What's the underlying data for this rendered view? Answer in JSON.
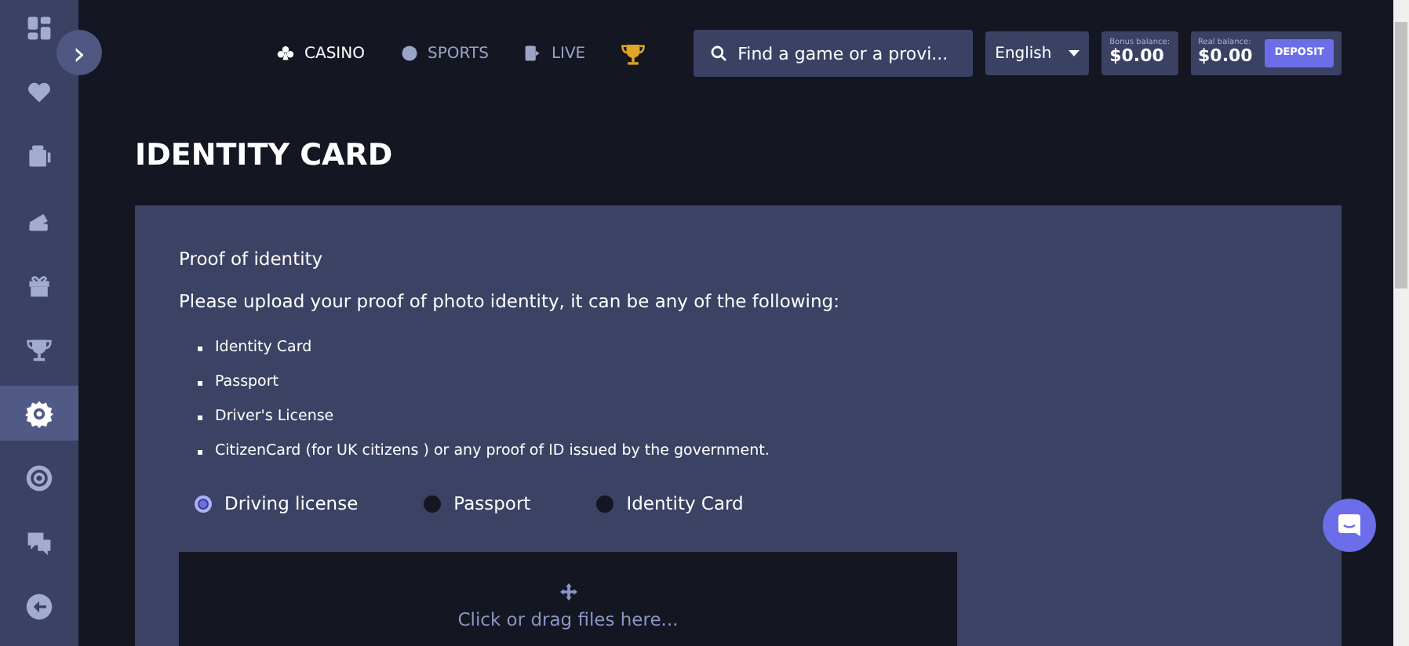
{
  "sidebar": {
    "items": [
      {
        "selected": false
      },
      {
        "selected": false
      },
      {
        "selected": false
      },
      {
        "selected": false
      },
      {
        "selected": false
      },
      {
        "selected": false
      },
      {
        "selected": true
      },
      {
        "selected": false
      },
      {
        "selected": false
      },
      {
        "selected": false
      }
    ]
  },
  "expand_button": {
    "label": "›"
  },
  "nav": [
    {
      "label": "CASINO",
      "selected": true
    },
    {
      "label": "SPORTS",
      "selected": false
    },
    {
      "label": "LIVE",
      "selected": false
    }
  ],
  "search": {
    "placeholder": "Find a game or a provi..."
  },
  "language": {
    "value": "English"
  },
  "bonus_balance": {
    "label": "Bonus balance:",
    "amount": "$0.00"
  },
  "real_balance": {
    "label": "Real balance:",
    "amount": "$0.00"
  },
  "deposit_button": "DEPOSIT",
  "page_title": "IDENTITY CARD",
  "card": {
    "heading": "Proof of identity",
    "intro": "Please upload your proof of photo identity, it can be any of the following:",
    "list": [
      "Identity Card",
      "Passport",
      "Driver's License",
      "CitizenCard (for UK citizens ) or any proof of ID issued by the government."
    ],
    "options": [
      {
        "label": "Driving license",
        "selected": true
      },
      {
        "label": "Passport",
        "selected": false
      },
      {
        "label": "Identity Card",
        "selected": false
      }
    ],
    "dropzone": {
      "text": "Click or drag files here..."
    }
  }
}
